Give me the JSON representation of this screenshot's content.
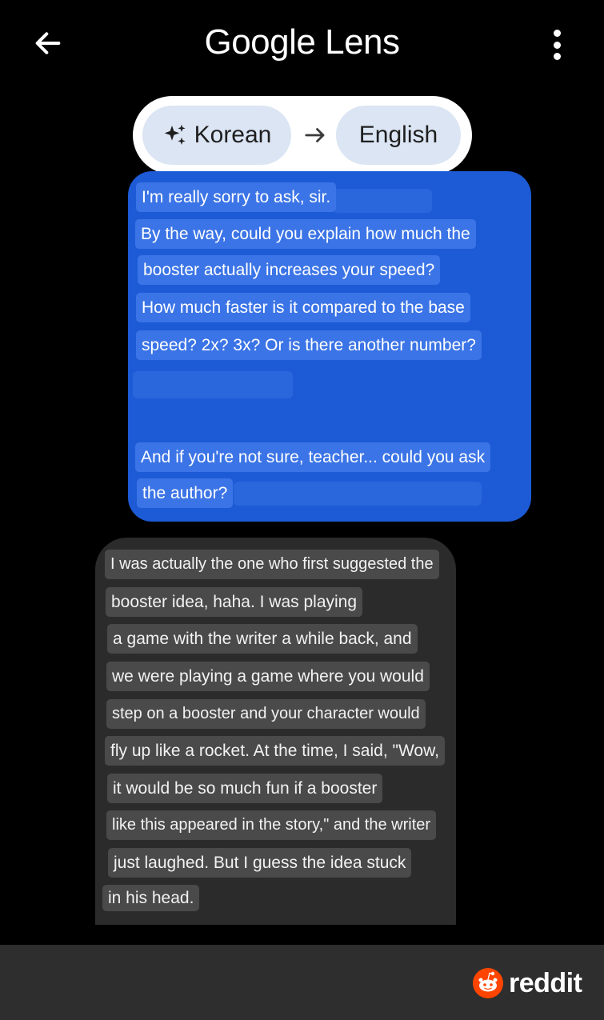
{
  "app": {
    "title": "Google Lens"
  },
  "icons": {
    "back": "arrow-back-icon",
    "menu": "more-vert-icon",
    "sparkle": "sparkle-icon",
    "arrow": "arrow-right-icon",
    "reddit": "reddit-logo-icon"
  },
  "translate": {
    "source_language": "Korean",
    "target_language": "English"
  },
  "colors": {
    "blue_bubble": "#1d5bd6",
    "dark_bubble": "#2b2b2b",
    "chip": "#dbe5f3",
    "reddit_orange": "#ff4500"
  },
  "messages": {
    "outgoing": {
      "lines": [
        "I'm really sorry to ask, sir.",
        "By the way, could you explain how much the",
        "booster actually increases your speed?",
        "How much faster is it compared to the base",
        "speed? 2x? 3x? Or is there another number?",
        "And if you're not sure, teacher... could you ask",
        "the author?"
      ]
    },
    "incoming": {
      "lines": [
        "I was actually the one who first suggested the",
        "booster idea, haha. I was playing",
        "a game with the writer a while back, and",
        "we were playing a game where you would",
        "step on a booster and your character would",
        "fly up like a rocket. At the time, I said, \"Wow,",
        "it would be so much fun if a booster",
        "like this appeared in the story,\" and the writer",
        "just laughed. But I guess the idea stuck",
        "in his head."
      ]
    }
  },
  "footer": {
    "brand": "reddit"
  }
}
